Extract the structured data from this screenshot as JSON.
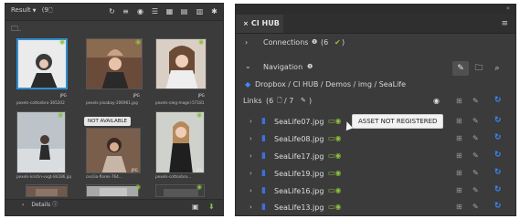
{
  "left_panel": {
    "result_label": "Result",
    "result_count": "(9",
    "tiles": [
      {
        "caption": "pexels-cottonbro-365202",
        "type": "JPG"
      },
      {
        "caption": "pexels-pixabay-206961.jpg",
        "type": "JPG"
      },
      {
        "caption": "pexels-oleg-magni-57181",
        "type": "JPG"
      },
      {
        "caption": "",
        "type": ""
      },
      {
        "caption": "pexels-kristin-vogt-84286.jpg",
        "type": "JPG"
      },
      {
        "caption": "cecilia-flores-764...",
        "type": "JPG"
      },
      {
        "caption": "pexels-cottonbro...",
        "type": "JPG"
      }
    ],
    "not_available": "NOT AVAILABLE",
    "details_label": "Details"
  },
  "right_panel": {
    "title": "CI HUB",
    "connections_label": "Connections",
    "connections_count": "(6",
    "navigation_label": "Navigation",
    "breadcrumb": "Dropbox / CI HUB / Demos / img / SeaLife",
    "links_label": "Links",
    "links_count": "(6",
    "links_total": "/ 7",
    "files": [
      {
        "name": "SeaLife07.jpg"
      },
      {
        "name": "SeaLife08.jpg"
      },
      {
        "name": "SeaLife17.jpg"
      },
      {
        "name": "SeaLife19.jpg"
      },
      {
        "name": "SeaLife16.jpg"
      },
      {
        "name": "SeaLife13.jpg"
      }
    ],
    "tooltip": "ASSET NOT REGISTERED"
  },
  "colors": {
    "accent_blue": "#3d8bff",
    "status_green": "#8ac13e",
    "selection": "#2f8fd1"
  }
}
